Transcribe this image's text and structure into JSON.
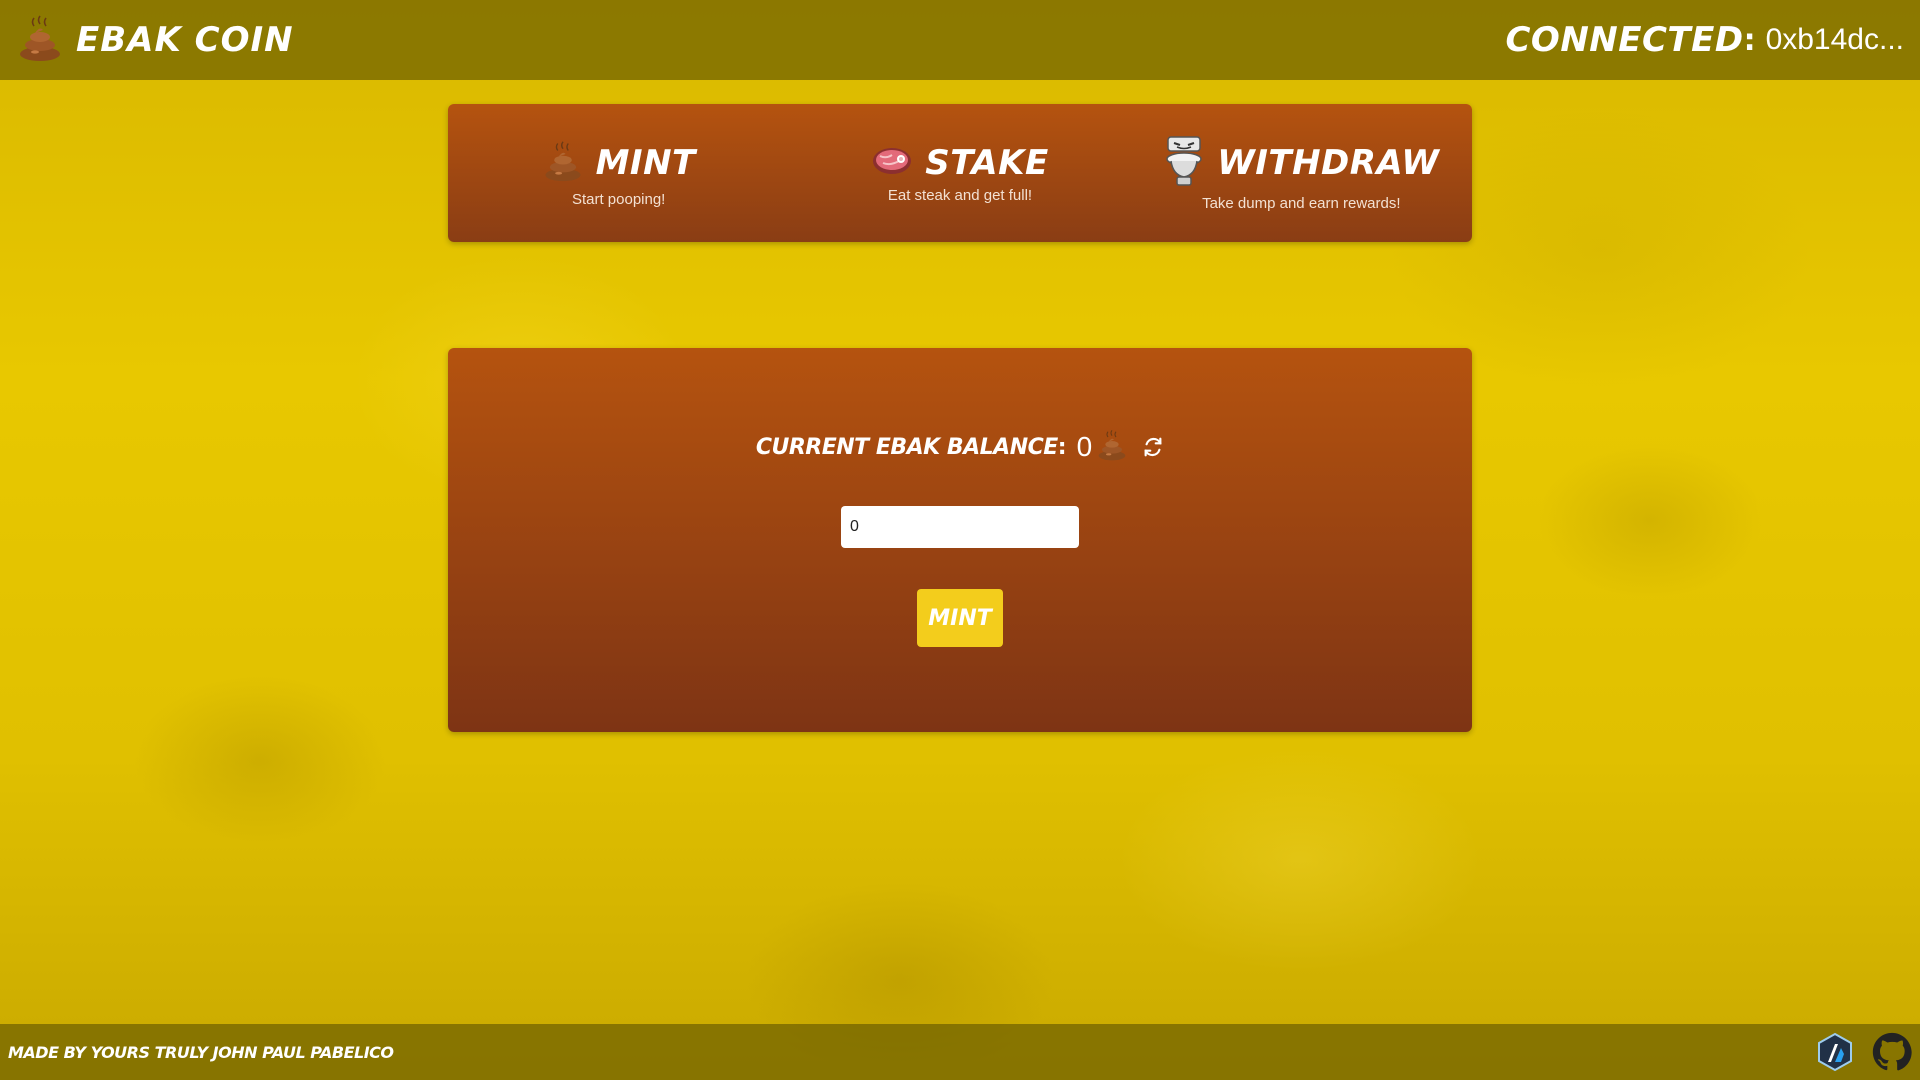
{
  "header": {
    "title": "EBAK COIN",
    "logo_icon": "poop-icon",
    "connected_label": "CONNECTED",
    "connected_colon": ":",
    "wallet_address": "0xb14dc..."
  },
  "nav": {
    "items": [
      {
        "label": "MINT",
        "subtitle": "Start pooping!",
        "icon": "poop-icon"
      },
      {
        "label": "STAKE",
        "subtitle": "Eat steak and get full!",
        "icon": "steak-icon"
      },
      {
        "label": "WITHDRAW",
        "subtitle": "Take dump and earn rewards!",
        "icon": "toilet-icon"
      }
    ]
  },
  "main": {
    "balance_label": "CURRENT EBAK BALANCE",
    "balance_colon": ":",
    "balance_value": "0",
    "amount_value": "0",
    "mint_button": "MINT"
  },
  "footer": {
    "credit": "MADE BY YOURS TRULY JOHN PAUL PABELICO",
    "icons": [
      "arbitrum-icon",
      "github-icon"
    ]
  },
  "colors": {
    "accent": "#f3cd1c",
    "card_top": "#b5530f",
    "card_bottom": "#7e3414",
    "bar": "#6e5f00"
  }
}
